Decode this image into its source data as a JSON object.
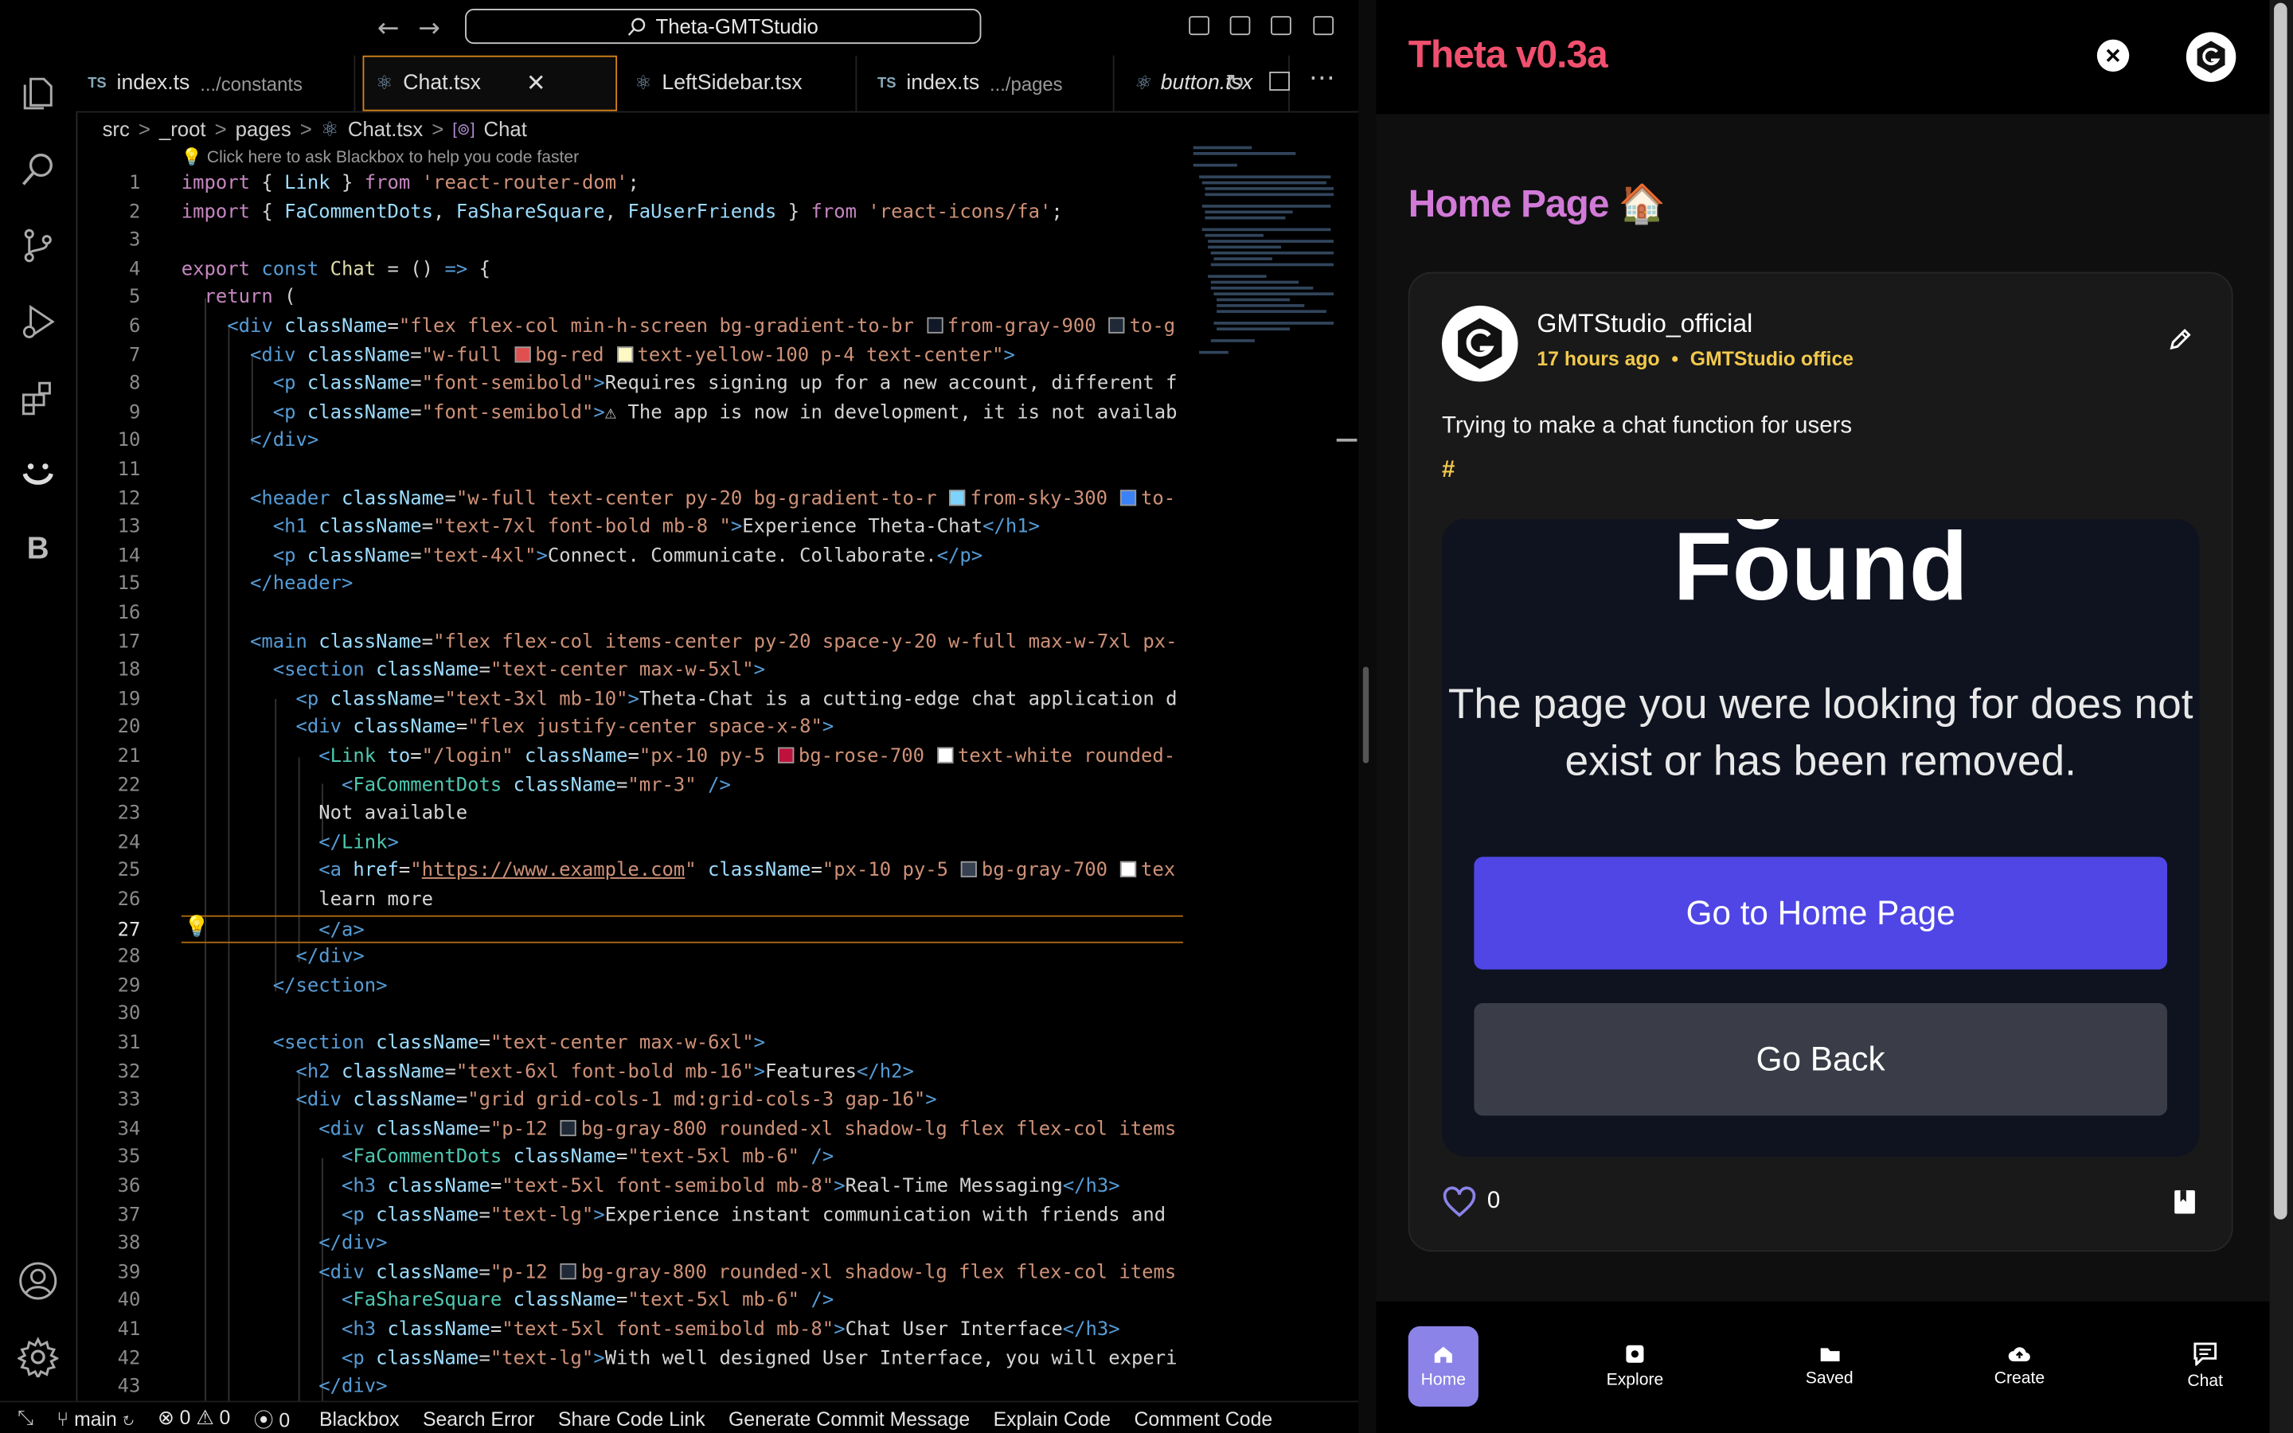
{
  "titlebar": {
    "search_text": "Theta-GMTStudio"
  },
  "tabs": [
    {
      "lang": "TS",
      "name": "index.ts",
      "path": ".../constants"
    },
    {
      "lang": "",
      "name": "Chat.tsx",
      "path": ""
    },
    {
      "lang": "",
      "name": "LeftSidebar.tsx",
      "path": ""
    },
    {
      "lang": "TS",
      "name": "index.ts",
      "path": ".../pages"
    },
    {
      "lang": "",
      "name": "button.tsx",
      "path": ""
    }
  ],
  "breadcrumb": [
    "src",
    "_root",
    "pages",
    "Chat.tsx",
    "Chat"
  ],
  "hint": "💡 Click here to ask Blackbox to help you code faster",
  "line_numbers": [
    "1",
    "2",
    "3",
    "4",
    "5",
    "6",
    "7",
    "8",
    "9",
    "10",
    "11",
    "12",
    "13",
    "14",
    "15",
    "16",
    "17",
    "18",
    "19",
    "20",
    "21",
    "22",
    "23",
    "24",
    "25",
    "26",
    "27",
    "28",
    "29",
    "30",
    "31",
    "32",
    "33",
    "34",
    "35",
    "36",
    "37",
    "38",
    "39",
    "40",
    "41",
    "42",
    "43"
  ],
  "code": {
    "l1_from": "'react-router-dom'",
    "l2_from": "'react-icons/fa'",
    "l6_cls": "\"flex flex-col min-h-screen bg-gradient-to-br ",
    "l6_c1": "from-gray-900 ",
    "l6_c2": "to-g",
    "l7_cls": "\"w-full ",
    "l7_c1": "bg-red ",
    "l7_c2": "text-yellow-100 p-4 text-center\"",
    "l8_text": "Requires signing up for a new account, different f",
    "l9_text": "⚠ The app is now in development, it is not availab",
    "l12_cls": "\"w-full text-center py-20 bg-gradient-to-r ",
    "l12_c1": "from-sky-300 ",
    "l12_c2": "to-",
    "l13_text": "Experience Theta-Chat",
    "l14_text": "Connect. Communicate. Collaborate.",
    "l17_cls": "\"flex flex-col items-center py-20 space-y-20 w-full max-w-7xl px-",
    "l18_cls": "\"text-center max-w-5xl\"",
    "l19_text": "Theta-Chat is a cutting-edge chat application d",
    "l20_cls": "\"flex justify-center space-x-8\"",
    "l21_to": "\"/login\" ",
    "l21_cls": "\"px-10 py-5 ",
    "l21_c1": "bg-rose-700 ",
    "l21_c2": "text-white rounded-",
    "l23_text": "Not available",
    "l25_href": "https://www.example.com",
    "l25_cls": "\"px-10 py-5 ",
    "l25_c1": "bg-gray-700 ",
    "l25_c2": "tex",
    "l26_text": "learn more",
    "l31_cls": "\"text-center max-w-6xl\"",
    "l32_text": "Features",
    "l33_cls": "\"grid grid-cols-1 md:grid-cols-3 gap-16\"",
    "l34_cls": "\"p-12 ",
    "l34_c1": "bg-gray-800 rounded-xl shadow-lg flex flex-col items",
    "l36_text": "Real-Time Messaging",
    "l37_text": "Experience instant communication with friends and",
    "l40_text": "Chat User Interface",
    "l41_text": "With well designed User Interface, you will experi"
  },
  "statusbar": {
    "branch": "main",
    "errors": "0",
    "warnings": "0",
    "ports": "0",
    "items": [
      "Blackbox",
      "Search Error",
      "Share Code Link",
      "Generate Commit Message",
      "Explain Code",
      "Comment Code"
    ]
  },
  "app": {
    "title": "Theta v0.3a",
    "page_heading": "Home Page 🏠",
    "post": {
      "author": "GMTStudio_official",
      "time": "17 hours ago",
      "location": "GMTStudio office",
      "text": "Trying to make a chat function for users",
      "hashtag": "#",
      "image_title_top": "Page Not",
      "image_title": "Found",
      "image_message": "The page you were looking for does not exist or has been removed.",
      "image_primary_button": "Go to Home Page",
      "image_secondary_button": "Go Back",
      "likes": "0"
    },
    "nav": [
      "Home",
      "Explore",
      "Saved",
      "Create",
      "Chat"
    ]
  },
  "colors": {
    "app_title": "#f0506e",
    "page_heading": "#d27ad8",
    "accent_yellow": "#f2c94c",
    "primary_button": "#4f46e5",
    "active_nav": "#8b83e8",
    "active_tab_border": "#d6821b"
  }
}
